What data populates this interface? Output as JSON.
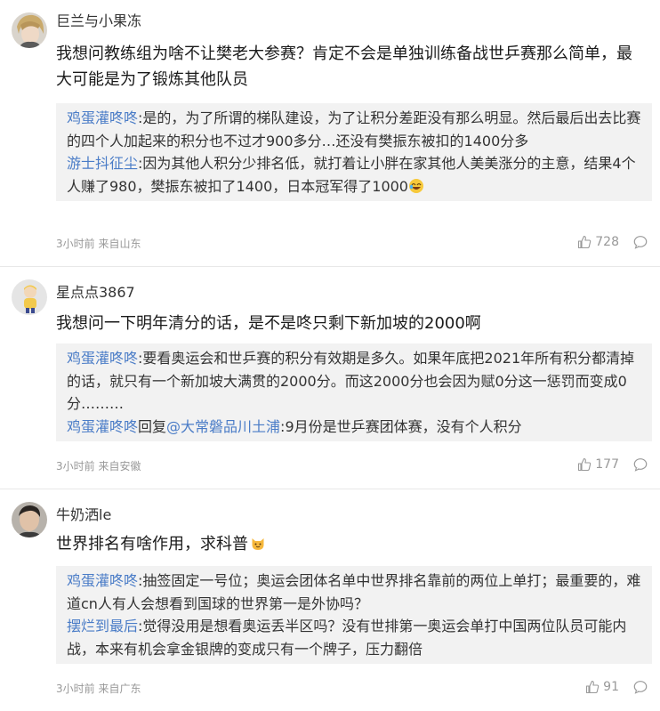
{
  "comments": [
    {
      "username": "巨兰与小果冻",
      "text": "我想问教练组为啥不让樊老大参赛？肯定不会是单独训练备战世乒赛那么简单，最大可能是为了锻炼其他队员",
      "replies": [
        {
          "author": "鸡蛋灌咚咚",
          "sep": ":",
          "text": "是的，为了所谓的梯队建设，为了让积分差距没有那么明显。然后最后出去比赛的四个人加起来的积分也不过才900多分…还没有樊振东被扣的1400分多"
        },
        {
          "author": "游士抖征尘",
          "sep": ":",
          "text": "因为其他人积分少排名低，就打着让小胖在家其他人美美涨分的主意，结果4个人赚了980，樊振东被扣了1400，日本冠军得了1000"
        }
      ],
      "time": "3小时前",
      "location": "来自山东",
      "likes": "728"
    },
    {
      "username": "星点点3867",
      "text": "我想问一下明年清分的话，是不是咚只剩下新加坡的2000啊",
      "replies": [
        {
          "author": "鸡蛋灌咚咚",
          "sep": ":",
          "text": "要看奥运会和世乒赛的积分有效期是多久。如果年底把2021年所有积分都清掉的话，就只有一个新加坡大满贯的2000分。而这2000分也会因为赋0分这一惩罚而变成0分………"
        },
        {
          "author": "鸡蛋灌咚咚",
          "reply_word": "回复",
          "mention": "@大常磐品川土浦",
          "sep": ":",
          "text": "9月份是世乒赛团体赛，没有个人积分"
        }
      ],
      "time": "3小时前",
      "location": "来自安徽",
      "likes": "177"
    },
    {
      "username": "牛奶洒le",
      "text": "世界排名有啥作用，求科普",
      "replies": [
        {
          "author": "鸡蛋灌咚咚",
          "sep": ":",
          "text": "抽签固定一号位；奥运会团体名单中世界排名靠前的两位上单打；最重要的，难道cn人有人会想看到国球的世界第一是外协吗？"
        },
        {
          "author": "摆烂到最后",
          "sep": ":",
          "text": "觉得没用是想看奥运丢半区吗？没有世排第一奥运会单打中国两位队员可能内战，本来有机会拿金银牌的变成只有一个牌子，压力翻倍"
        }
      ],
      "time": "3小时前",
      "location": "来自广东",
      "likes": "91"
    }
  ],
  "colors": {
    "link": "#4a7cc7",
    "reply_bg": "#f2f2f2",
    "meta": "#999999"
  },
  "icons": {
    "like": "thumbs-up-icon",
    "reply": "speech-bubble-icon",
    "emoji_1": "laugh-emoji",
    "emoji_2": "cat-emoji"
  }
}
